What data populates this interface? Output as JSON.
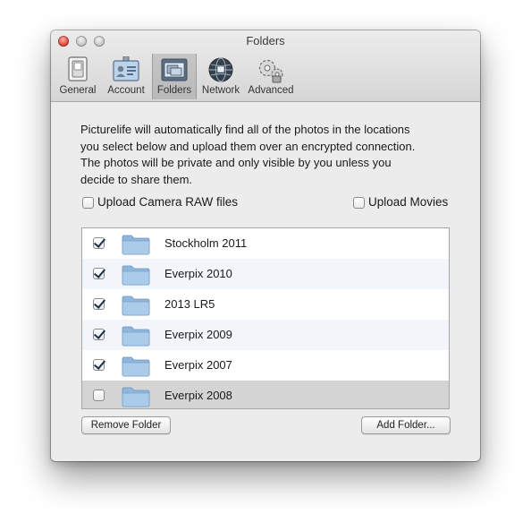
{
  "window": {
    "title": "Folders"
  },
  "toolbar": {
    "items": [
      {
        "label": "General",
        "icon": "general-switch-icon"
      },
      {
        "label": "Account",
        "icon": "account-id-card-icon"
      },
      {
        "label": "Folders",
        "icon": "folders-icon",
        "selected": true
      },
      {
        "label": "Network",
        "icon": "network-globe-icon"
      },
      {
        "label": "Advanced",
        "icon": "advanced-gears-icon"
      }
    ]
  },
  "description": [
    "Picturelife will automatically find all of the photos in the locations",
    "you select below and upload them over an encrypted connection.",
    "The photos will be private and only visible by you unless you",
    "decide to share them."
  ],
  "options": {
    "upload_raw": {
      "label": "Upload Camera RAW files",
      "checked": false
    },
    "upload_movies": {
      "label": "Upload Movies",
      "checked": false
    }
  },
  "folders": [
    {
      "name": "Stockholm 2011",
      "checked": true
    },
    {
      "name": "Everpix 2010",
      "checked": true
    },
    {
      "name": "2013 LR5",
      "checked": true
    },
    {
      "name": "Everpix 2009",
      "checked": true
    },
    {
      "name": "Everpix 2007",
      "checked": true
    },
    {
      "name": "Everpix 2008",
      "checked": false,
      "selected": true
    }
  ],
  "buttons": {
    "remove": "Remove Folder",
    "add": "Add Folder..."
  },
  "colors": {
    "close_button": "#e0443a",
    "folder_icon": "#9ec3e6",
    "selected_row": "#d4d4d4",
    "alt_row": "#f2f5fa"
  }
}
